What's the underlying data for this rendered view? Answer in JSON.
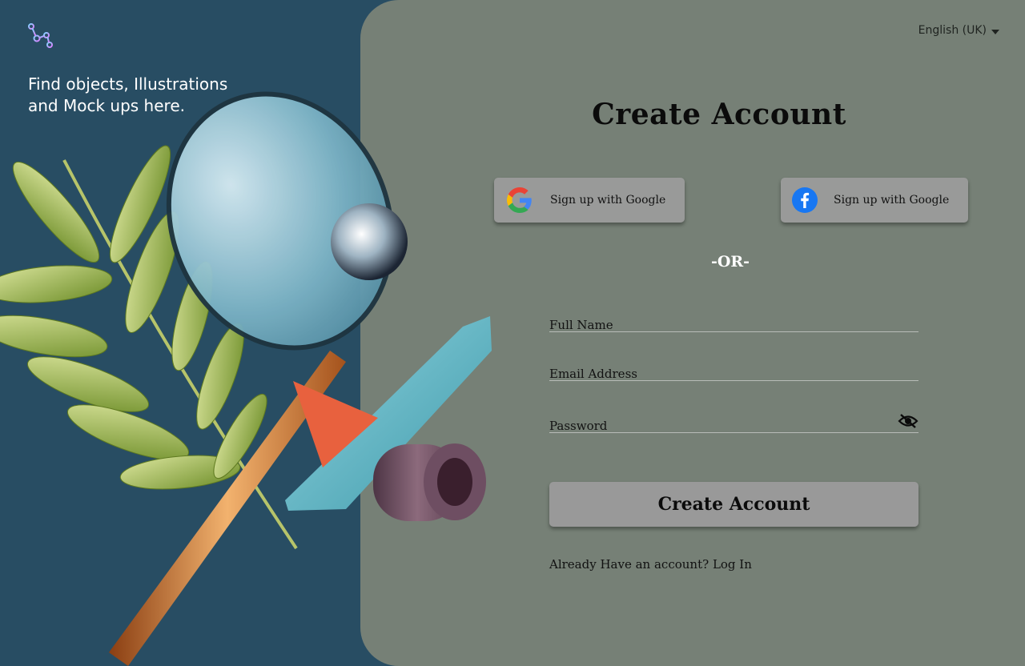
{
  "hero": {
    "tagline": "Find objects, Illustrations and Mock ups here."
  },
  "icons": {
    "logo": "graph-nodes-logo-icon",
    "google": "google-g-icon",
    "facebook": "facebook-f-icon",
    "caret": "caret-down-icon",
    "eye": "eye-slash-icon"
  },
  "header": {
    "language": "English (UK)"
  },
  "form": {
    "title": "Create Account",
    "google_label": "Sign up with Google",
    "facebook_label": "Sign up with Google",
    "divider": "-OR-",
    "full_name_label": "Full Name",
    "email_label": "Email Address",
    "password_label": "Password",
    "submit_label": "Create Account",
    "already_text": "Already Have an account?",
    "login_link": "Log In"
  },
  "colors": {
    "left_bg": "#284d63",
    "panel_bg": "#768076",
    "button_bg": "#999999",
    "facebook_blue": "#1877f2"
  }
}
